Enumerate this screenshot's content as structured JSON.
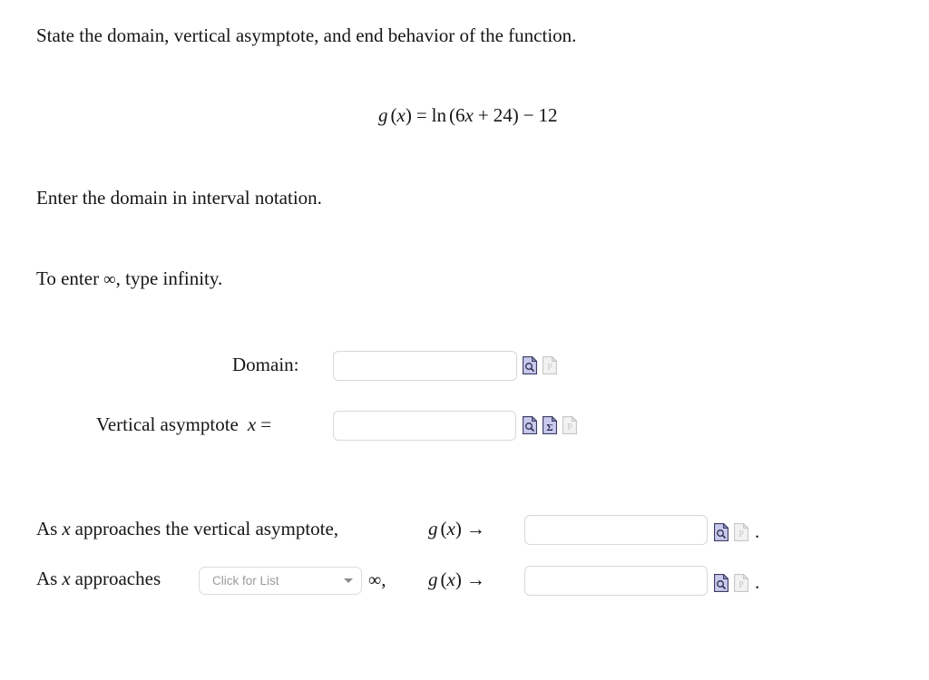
{
  "page": {
    "background": "#ffffff"
  },
  "prompt": {
    "line1": "State the domain, vertical asymptote, and end behavior of the function.",
    "line2": "Enter the domain in interval notation.",
    "line3_prefix": "To enter",
    "line3_symbol": "∞",
    "line3_suffix": ", type infinity."
  },
  "formula": {
    "g": "g",
    "lparen": "(",
    "x": "x",
    "rparen": ")",
    "equals": "=",
    "ln": "ln",
    "lparen2": "(",
    "coefficient": "6",
    "var": "x",
    "plus": "+",
    "constant": "24",
    "rparen2": ")",
    "minus": "−",
    "offset": "12",
    "plain": "g(x) = ln(6x + 24) − 12"
  },
  "domain_row": {
    "label": "Domain:",
    "input_value": "",
    "input_placeholder": "",
    "icons": [
      {
        "name": "preview-answer-icon",
        "glyph": "magnifier",
        "state": "enabled"
      },
      {
        "name": "palette-icon",
        "glyph": "P",
        "state": "disabled"
      }
    ]
  },
  "asymptote_row": {
    "label": "Vertical asymptote",
    "variable": "x",
    "equals": "=",
    "input_value": "",
    "input_placeholder": "",
    "icons": [
      {
        "name": "preview-answer-icon",
        "glyph": "magnifier",
        "state": "enabled"
      },
      {
        "name": "sigma-symbol-icon",
        "glyph": "Σ",
        "state": "enabled"
      },
      {
        "name": "palette-icon",
        "glyph": "P",
        "state": "disabled"
      }
    ]
  },
  "end_behavior": {
    "row1": {
      "text": "As x approaches the vertical asymptote,",
      "text_prefix": "As",
      "text_var": "x",
      "text_suffix": "approaches the vertical asymptote,",
      "func_g": "g",
      "func_lparen": "(",
      "func_x": "x",
      "func_rparen": ")",
      "arrow": "→",
      "input_value": "",
      "input_placeholder": "",
      "period": ".",
      "icons": [
        {
          "name": "preview-answer-icon",
          "glyph": "magnifier",
          "state": "enabled"
        },
        {
          "name": "palette-icon",
          "glyph": "P",
          "state": "disabled"
        }
      ]
    },
    "row2": {
      "text_prefix": "As",
      "text_var": "x",
      "text_suffix": "approaches",
      "dropdown_label": "Click for List",
      "dropdown_value": "",
      "infinity": "∞",
      "comma": ",",
      "func_g": "g",
      "func_lparen": "(",
      "func_x": "x",
      "func_rparen": ")",
      "arrow": "→",
      "input_value": "",
      "input_placeholder": "",
      "period": ".",
      "icons": [
        {
          "name": "preview-answer-icon",
          "glyph": "magnifier",
          "state": "enabled"
        },
        {
          "name": "palette-icon",
          "glyph": "P",
          "state": "disabled"
        }
      ]
    }
  },
  "colors": {
    "icon_enabled_fill": "#c9c9ee",
    "icon_enabled_stroke": "#3c3c63",
    "icon_disabled_fill": "#efefef",
    "icon_disabled_stroke": "#c2c2c2",
    "input_border": "#d9d9d9",
    "text": "#161616"
  }
}
